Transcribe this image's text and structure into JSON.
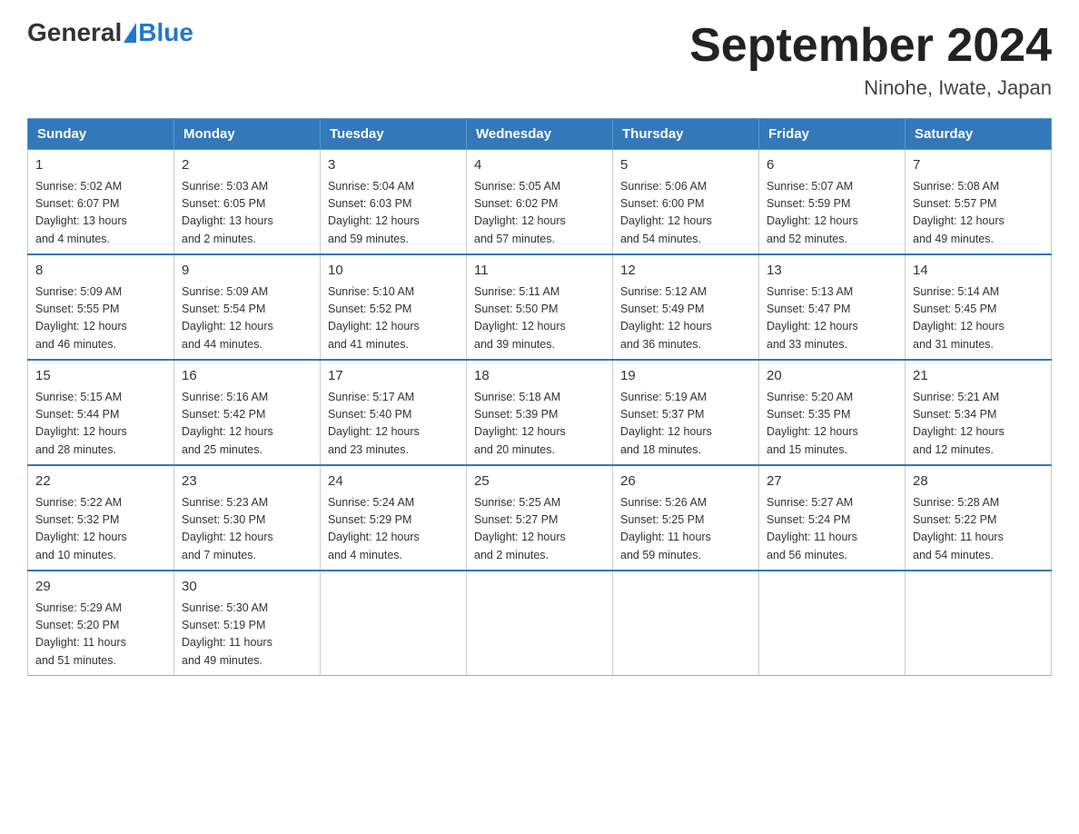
{
  "logo": {
    "general": "General",
    "blue": "Blue"
  },
  "title": "September 2024",
  "subtitle": "Ninohe, Iwate, Japan",
  "weekdays": [
    "Sunday",
    "Monday",
    "Tuesday",
    "Wednesday",
    "Thursday",
    "Friday",
    "Saturday"
  ],
  "weeks": [
    [
      {
        "day": "1",
        "info": "Sunrise: 5:02 AM\nSunset: 6:07 PM\nDaylight: 13 hours\nand 4 minutes."
      },
      {
        "day": "2",
        "info": "Sunrise: 5:03 AM\nSunset: 6:05 PM\nDaylight: 13 hours\nand 2 minutes."
      },
      {
        "day": "3",
        "info": "Sunrise: 5:04 AM\nSunset: 6:03 PM\nDaylight: 12 hours\nand 59 minutes."
      },
      {
        "day": "4",
        "info": "Sunrise: 5:05 AM\nSunset: 6:02 PM\nDaylight: 12 hours\nand 57 minutes."
      },
      {
        "day": "5",
        "info": "Sunrise: 5:06 AM\nSunset: 6:00 PM\nDaylight: 12 hours\nand 54 minutes."
      },
      {
        "day": "6",
        "info": "Sunrise: 5:07 AM\nSunset: 5:59 PM\nDaylight: 12 hours\nand 52 minutes."
      },
      {
        "day": "7",
        "info": "Sunrise: 5:08 AM\nSunset: 5:57 PM\nDaylight: 12 hours\nand 49 minutes."
      }
    ],
    [
      {
        "day": "8",
        "info": "Sunrise: 5:09 AM\nSunset: 5:55 PM\nDaylight: 12 hours\nand 46 minutes."
      },
      {
        "day": "9",
        "info": "Sunrise: 5:09 AM\nSunset: 5:54 PM\nDaylight: 12 hours\nand 44 minutes."
      },
      {
        "day": "10",
        "info": "Sunrise: 5:10 AM\nSunset: 5:52 PM\nDaylight: 12 hours\nand 41 minutes."
      },
      {
        "day": "11",
        "info": "Sunrise: 5:11 AM\nSunset: 5:50 PM\nDaylight: 12 hours\nand 39 minutes."
      },
      {
        "day": "12",
        "info": "Sunrise: 5:12 AM\nSunset: 5:49 PM\nDaylight: 12 hours\nand 36 minutes."
      },
      {
        "day": "13",
        "info": "Sunrise: 5:13 AM\nSunset: 5:47 PM\nDaylight: 12 hours\nand 33 minutes."
      },
      {
        "day": "14",
        "info": "Sunrise: 5:14 AM\nSunset: 5:45 PM\nDaylight: 12 hours\nand 31 minutes."
      }
    ],
    [
      {
        "day": "15",
        "info": "Sunrise: 5:15 AM\nSunset: 5:44 PM\nDaylight: 12 hours\nand 28 minutes."
      },
      {
        "day": "16",
        "info": "Sunrise: 5:16 AM\nSunset: 5:42 PM\nDaylight: 12 hours\nand 25 minutes."
      },
      {
        "day": "17",
        "info": "Sunrise: 5:17 AM\nSunset: 5:40 PM\nDaylight: 12 hours\nand 23 minutes."
      },
      {
        "day": "18",
        "info": "Sunrise: 5:18 AM\nSunset: 5:39 PM\nDaylight: 12 hours\nand 20 minutes."
      },
      {
        "day": "19",
        "info": "Sunrise: 5:19 AM\nSunset: 5:37 PM\nDaylight: 12 hours\nand 18 minutes."
      },
      {
        "day": "20",
        "info": "Sunrise: 5:20 AM\nSunset: 5:35 PM\nDaylight: 12 hours\nand 15 minutes."
      },
      {
        "day": "21",
        "info": "Sunrise: 5:21 AM\nSunset: 5:34 PM\nDaylight: 12 hours\nand 12 minutes."
      }
    ],
    [
      {
        "day": "22",
        "info": "Sunrise: 5:22 AM\nSunset: 5:32 PM\nDaylight: 12 hours\nand 10 minutes."
      },
      {
        "day": "23",
        "info": "Sunrise: 5:23 AM\nSunset: 5:30 PM\nDaylight: 12 hours\nand 7 minutes."
      },
      {
        "day": "24",
        "info": "Sunrise: 5:24 AM\nSunset: 5:29 PM\nDaylight: 12 hours\nand 4 minutes."
      },
      {
        "day": "25",
        "info": "Sunrise: 5:25 AM\nSunset: 5:27 PM\nDaylight: 12 hours\nand 2 minutes."
      },
      {
        "day": "26",
        "info": "Sunrise: 5:26 AM\nSunset: 5:25 PM\nDaylight: 11 hours\nand 59 minutes."
      },
      {
        "day": "27",
        "info": "Sunrise: 5:27 AM\nSunset: 5:24 PM\nDaylight: 11 hours\nand 56 minutes."
      },
      {
        "day": "28",
        "info": "Sunrise: 5:28 AM\nSunset: 5:22 PM\nDaylight: 11 hours\nand 54 minutes."
      }
    ],
    [
      {
        "day": "29",
        "info": "Sunrise: 5:29 AM\nSunset: 5:20 PM\nDaylight: 11 hours\nand 51 minutes."
      },
      {
        "day": "30",
        "info": "Sunrise: 5:30 AM\nSunset: 5:19 PM\nDaylight: 11 hours\nand 49 minutes."
      },
      {
        "day": "",
        "info": ""
      },
      {
        "day": "",
        "info": ""
      },
      {
        "day": "",
        "info": ""
      },
      {
        "day": "",
        "info": ""
      },
      {
        "day": "",
        "info": ""
      }
    ]
  ]
}
